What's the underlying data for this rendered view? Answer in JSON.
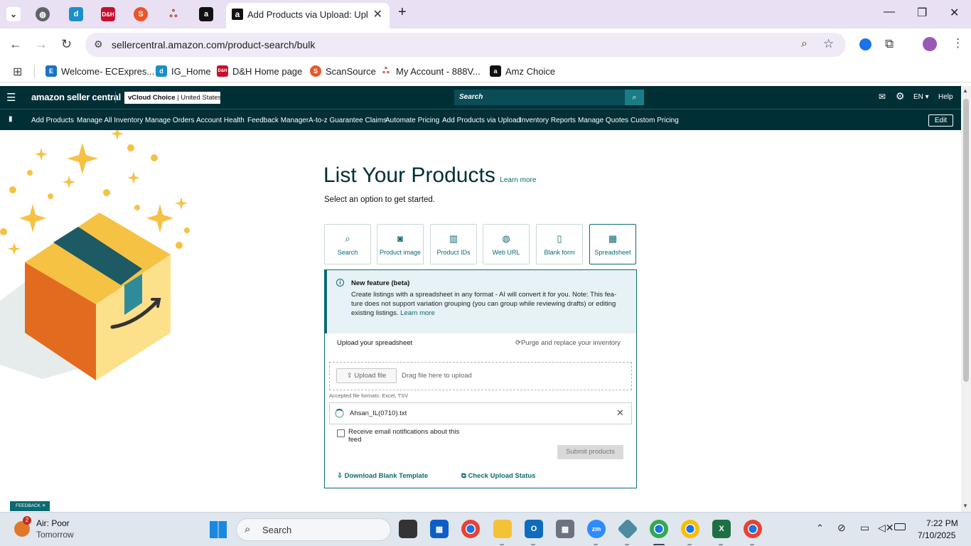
{
  "browser": {
    "active_tab_title": "Add Products via Upload: Uploa",
    "url": "sellercentral.amazon.com/product-search/bulk",
    "bookmarks": [
      "Welcome- ECExpres...",
      "IG_Home",
      "D&H Home page",
      "ScanSource",
      "My Account - 888V...",
      "Amz Choice"
    ]
  },
  "header": {
    "logo": "amazon seller central",
    "store": "vCloud Choice",
    "marketplace": "United States",
    "search_placeholder": "Search",
    "lang": "EN",
    "help": "Help"
  },
  "nav": {
    "items": [
      "Add Products",
      "Manage All Inventory",
      "Manage Orders",
      "Account Health",
      "Feedback Manager",
      "A-to-z Guarantee Claims",
      "Automate Pricing",
      "Add Products via Upload",
      "Inventory Reports",
      "Manage Quotes",
      "Custom Pricing"
    ],
    "edit": "Edit"
  },
  "main": {
    "title": "List Your Products",
    "learn_more": "Learn more",
    "subtitle": "Select an option to get started.",
    "options": [
      "Search",
      "Product image",
      "Product IDs",
      "Web URL",
      "Blank form",
      "Spreadsheet"
    ],
    "selected_option": "Spreadsheet"
  },
  "beta": {
    "heading": "New feature (beta)",
    "line1": "Create listings with a spreadsheet in any format - AI will convert it for you. Note: This fea-",
    "line2": "ture does not support variation grouping (you can group while reviewing drafts) or editing",
    "line3": "existing listings.",
    "learn_more": "Learn more"
  },
  "upload": {
    "label": "Upload your spreadsheet",
    "purge": "Purge and replace your inventory",
    "button": "Upload file",
    "drag": "Drag file here to upload",
    "formats": "Accepted file formats: Excel, TSV",
    "file_name": "Ahsan_IL(0710).txt",
    "email_line1": "Receive email notifications about this",
    "email_line2": "feed",
    "submit": "Submit products",
    "download_template": "Download Blank Template",
    "check_status": "Check Upload Status"
  },
  "feedback": "FEEDBACK",
  "taskbar": {
    "weather_title": "Air: Poor",
    "weather_sub": "Tomorrow",
    "weather_badge": "2",
    "search": "Search",
    "time": "7:22 PM",
    "date": "7/10/2025"
  },
  "colors": {
    "teal_dark": "#002f36",
    "teal_accent": "#0b6a74",
    "tab_bg": "#e9e0f4"
  }
}
